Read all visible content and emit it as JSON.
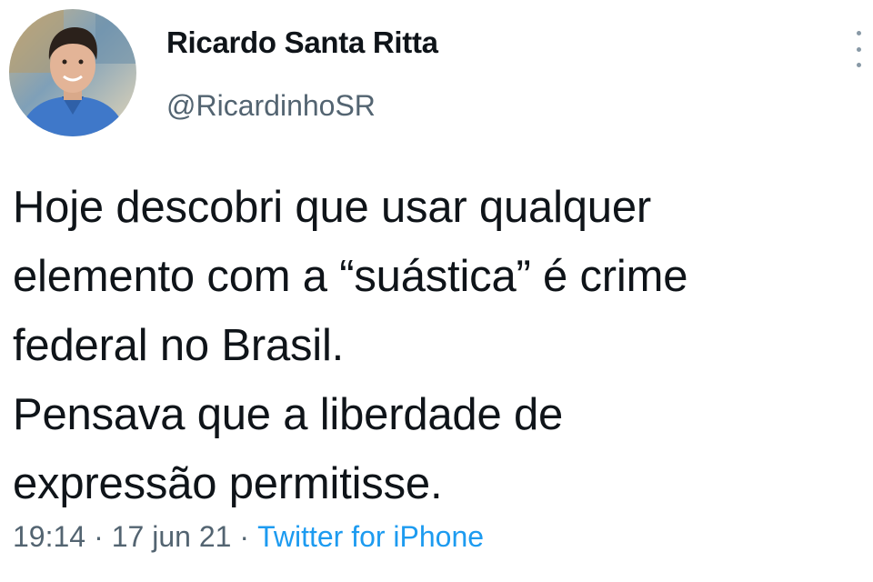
{
  "author": {
    "display_name": "Ricardo Santa Ritta",
    "handle": "@RicardinhoSR",
    "avatar_icon": "profile-photo"
  },
  "more_icon": "vertical-ellipsis-icon",
  "tweet": {
    "lines": [
      "Hoje descobri que usar qualquer",
      "elemento com a “suástica” é crime",
      "federal no Brasil.",
      "Pensava que a liberdade de",
      "expressão permitisse."
    ]
  },
  "meta": {
    "time": "19:14",
    "separator": "·",
    "date": "17 jun 21",
    "source": "Twitter for iPhone"
  },
  "colors": {
    "text": "#0f1419",
    "secondary": "#536471",
    "link": "#1d9bf0",
    "background": "#ffffff"
  }
}
